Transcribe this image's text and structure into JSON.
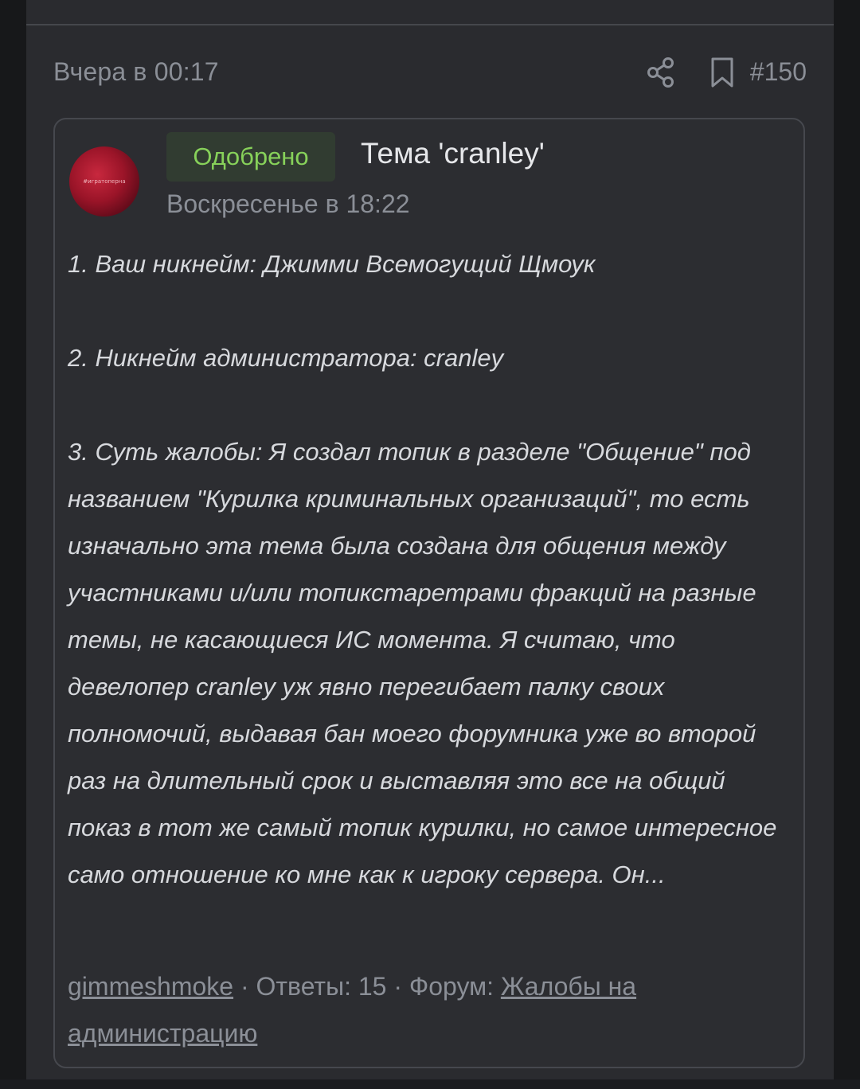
{
  "post": {
    "date": "Вчера в 00:17",
    "number": "#150",
    "icons": {
      "share": "share-icon",
      "bookmark": "bookmark-icon"
    }
  },
  "thread": {
    "status_badge": "Одобрено",
    "status_color": "#87d15a",
    "title": "Тема 'cranley'",
    "date": "Воскресенье в 18:22",
    "avatar_caption": "#игратоперна",
    "body": [
      "1. Ваш никнейм: Джимми Всемогущий Щмоук",
      "2. Никнейм администратора: cranley",
      "3. Суть жалобы: Я создал топик в разделе \"Общение\" под названием \"Курилка криминальных организаций\", то есть изначально эта тема была создана для общения между участниками и/или топикстаретрами фракций на разные темы, не касающиеся ИС момента. Я считаю, что девелопер cranley уж явно перегибает палку своих полномочий, выдавая бан моего форумника уже во второй раз на длительный срок и выставляя это все на общий показ в тот же самый топик курилки, но самое интересное само отношение ко мне как к игроку сервера. Он..."
    ],
    "footer": {
      "author": "gimmeshmoke",
      "separator": " · ",
      "replies": "Ответы: 15",
      "forum_label": "Форум: ",
      "forum_name": "Жалобы на администрацию"
    }
  }
}
